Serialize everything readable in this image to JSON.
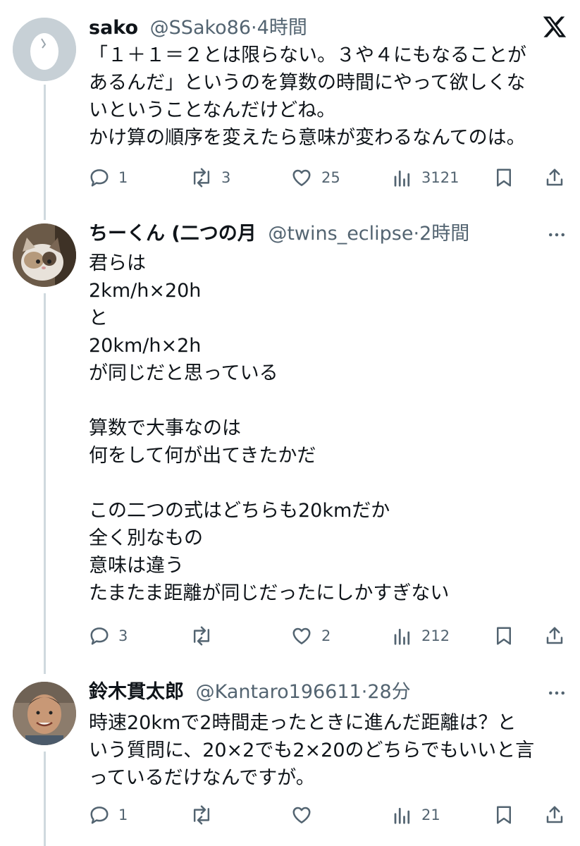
{
  "tweets": [
    {
      "name": "sako",
      "handle": "@SSako86",
      "time": "4時間",
      "text": "「１＋１＝２とは限らない。３や４にもなることが\nあるんだ」というのを算数の時間にやって欲しくな\nいということなんだけどね。\nかけ算の順序を変えたら意味が変わるなんてのは。",
      "reply_count": "1",
      "retweet_count": "3",
      "like_count": "25",
      "view_count": "3121",
      "corner_icon": "x-logo-icon"
    },
    {
      "name": "ちーくん (二つの月",
      "handle": "@twins_eclipse",
      "time": "2時間",
      "text": "君らは\n2km/h×20h\nと\n20km/h×2h\nが同じだと思っている\n\n算数で大事なのは\n何をして何が出てきたかだ\n\nこの二つの式はどちらも20kmだか\n全く別なもの\n意味は違う\nたまたま距離が同じだったにしかすぎない",
      "reply_count": "3",
      "retweet_count": "",
      "like_count": "2",
      "view_count": "212",
      "corner_icon": "more-icon"
    },
    {
      "name": "鈴木貫太郎",
      "handle": "@Kantaro196611",
      "time": "28分",
      "text": "時速20kmで2時間走ったときに進んだ距離は？と\nいう質問に、20×2でも2×20のどちらでもいいと言\nっているだけなんですが。",
      "reply_count": "1",
      "retweet_count": "",
      "like_count": "",
      "view_count": "21",
      "corner_icon": "more-icon"
    }
  ],
  "separator": "·",
  "colors": {
    "text": "#0f1419",
    "secondary": "#536471",
    "thread_line": "#cfd9de"
  }
}
